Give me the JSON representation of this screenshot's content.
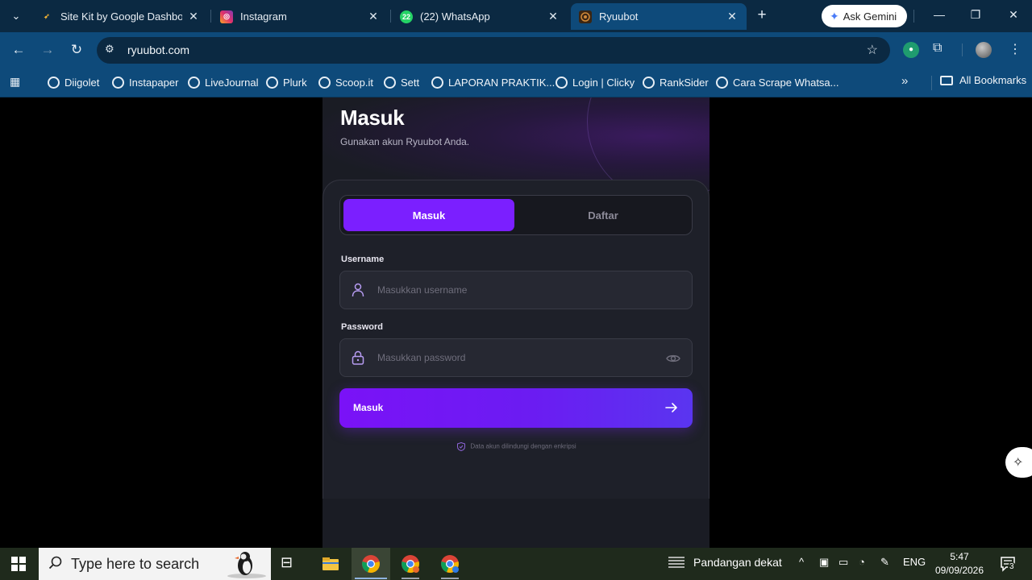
{
  "browser": {
    "tabs": [
      {
        "title": "Site Kit by Google Dashboard",
        "active": false
      },
      {
        "title": "Instagram",
        "active": false
      },
      {
        "title": "(22) WhatsApp",
        "active": false,
        "badge": "22"
      },
      {
        "title": "Ryuubot",
        "active": true
      }
    ],
    "gemini_label": "Ask Gemini",
    "url": "ryuubot.com",
    "bookmarks": [
      "Diigolet",
      "Instapaper",
      "LiveJournal",
      "Plurk",
      "Scoop.it",
      "Sett",
      "LAPORAN PRAKTIK...",
      "Login | Clicky",
      "RankSider",
      "Cara Scrape Whatsa..."
    ],
    "all_bookmarks": "All Bookmarks"
  },
  "page": {
    "heading": "Masuk",
    "subheading": "Gunakan akun Ryuubot Anda.",
    "tabs": {
      "login": "Masuk",
      "register": "Daftar"
    },
    "username": {
      "label": "Username",
      "placeholder": "Masukkan username"
    },
    "password": {
      "label": "Password",
      "placeholder": "Masukkan password"
    },
    "submit_label": "Masuk",
    "security_note": "Data akun dilindungi dengan enkripsi"
  },
  "taskbar": {
    "search_placeholder": "Type here to search",
    "weather": "Pandangan dekat",
    "language": "ENG",
    "time": "5:47",
    "date": "09/09/2026",
    "notifications": "3"
  },
  "colors": {
    "accent": "#7b1fff",
    "chrome": "#0e4a7a",
    "tabstrip": "#0b2942",
    "page_bg": "#1a1c24"
  }
}
